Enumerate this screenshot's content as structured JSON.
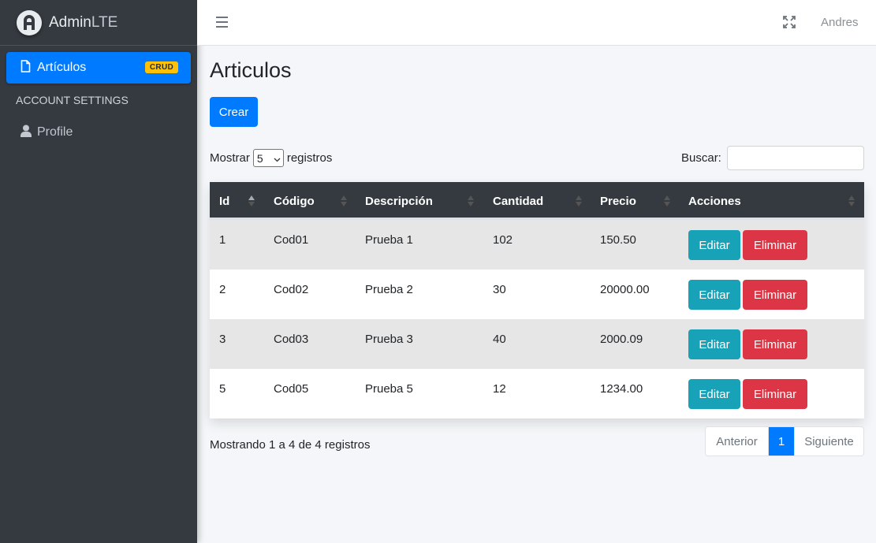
{
  "brand": {
    "name_bold": "Admin",
    "name_light": "LTE"
  },
  "sidebar": {
    "active_item": {
      "label": "Artículos",
      "badge": "CRUD",
      "icon": "file-icon"
    },
    "header": "ACCOUNT SETTINGS",
    "profile": {
      "label": "Profile",
      "icon": "user-icon"
    }
  },
  "topbar": {
    "user": "Andres",
    "menu_icon": "hamburger-icon",
    "fullscreen_icon": "expand-icon"
  },
  "page": {
    "title": "Articulos",
    "create_label": "Crear"
  },
  "length": {
    "prefix": "Mostrar",
    "value": "5",
    "suffix": "registros"
  },
  "search": {
    "label": "Buscar:",
    "value": ""
  },
  "table": {
    "headers": [
      "Id",
      "Código",
      "Descripción",
      "Cantidad",
      "Precio",
      "Acciones"
    ],
    "rows": [
      {
        "id": "1",
        "codigo": "Cod01",
        "descripcion": "Prueba 1",
        "cantidad": "102",
        "precio": "150.50"
      },
      {
        "id": "2",
        "codigo": "Cod02",
        "descripcion": "Prueba 2",
        "cantidad": "30",
        "precio": "20000.00"
      },
      {
        "id": "3",
        "codigo": "Cod03",
        "descripcion": "Prueba 3",
        "cantidad": "40",
        "precio": "2000.09"
      },
      {
        "id": "5",
        "codigo": "Cod05",
        "descripcion": "Prueba 5",
        "cantidad": "12",
        "precio": "1234.00"
      }
    ],
    "edit_label": "Editar",
    "delete_label": "Eliminar"
  },
  "footer": {
    "info": "Mostrando 1 a 4 de 4 registros",
    "prev": "Anterior",
    "page": "1",
    "next": "Siguiente"
  },
  "colors": {
    "primary": "#007bff",
    "info": "#17a2b8",
    "danger": "#dc3545",
    "warning": "#ffc107",
    "sidebar": "#343a40"
  }
}
